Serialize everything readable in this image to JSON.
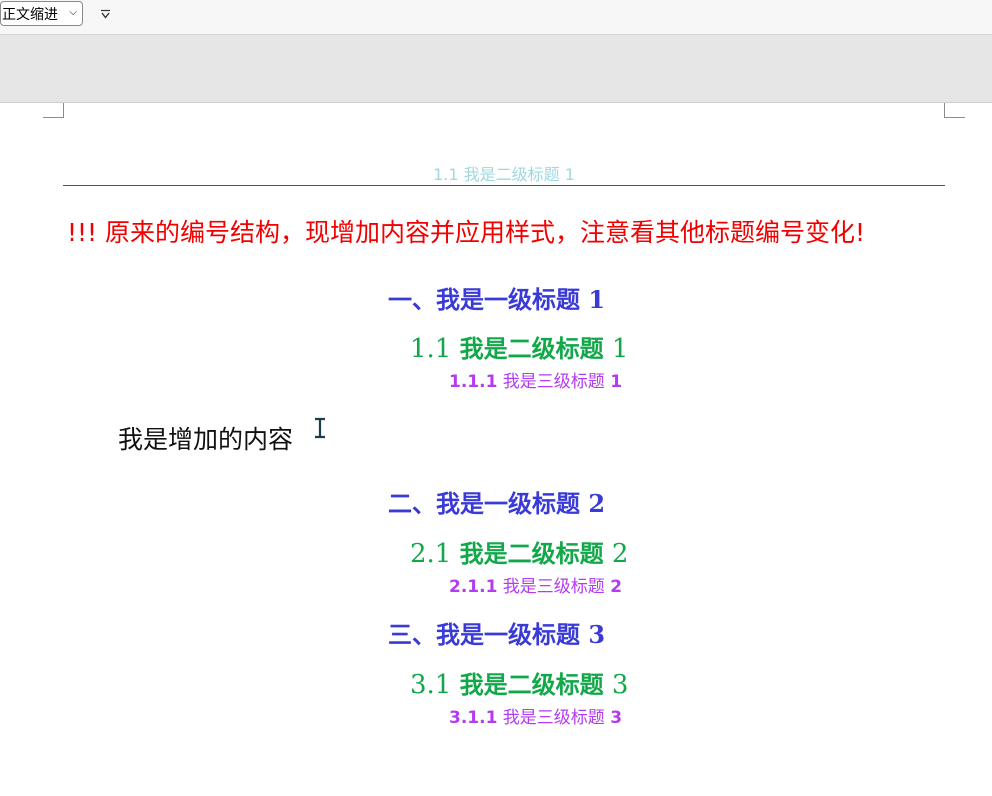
{
  "toolbar": {
    "style_select_value": "正文缩进",
    "quick_access_icon": "chevron-menu-icon"
  },
  "document": {
    "header_text": "1.1 我是二级标题 1",
    "notice": "!!!  原来的编号结构，现增加内容并应用样式，注意看其他标题编号变化!",
    "headings": [
      {
        "h1": "一、我是一级标题 1",
        "h2_num": "1.1 ",
        "h2_text": "我是二级标题",
        "h2_suffix": " 1",
        "h3_num": "1.1.1",
        "h3_text": " 我是三级标题 ",
        "h3_suffix": "1"
      },
      {
        "h1": "二、我是一级标题 2",
        "h2_num": "2.1 ",
        "h2_text": "我是二级标题",
        "h2_suffix": " 2",
        "h3_num": "2.1.1",
        "h3_text": " 我是三级标题 ",
        "h3_suffix": "2"
      },
      {
        "h1": "三、我是一级标题 3",
        "h2_num": "3.1 ",
        "h2_text": "我是二级标题",
        "h2_suffix": " 3",
        "h3_num": "3.1.1",
        "h3_text": " 我是三级标题 ",
        "h3_suffix": "3"
      }
    ],
    "body_text": "我是增加的内容"
  },
  "colors": {
    "notice": "#f20000",
    "heading1": "#3a3ad6",
    "heading2": "#12a84a",
    "heading3": "#b43cf0",
    "header": "#9fd8e0"
  }
}
